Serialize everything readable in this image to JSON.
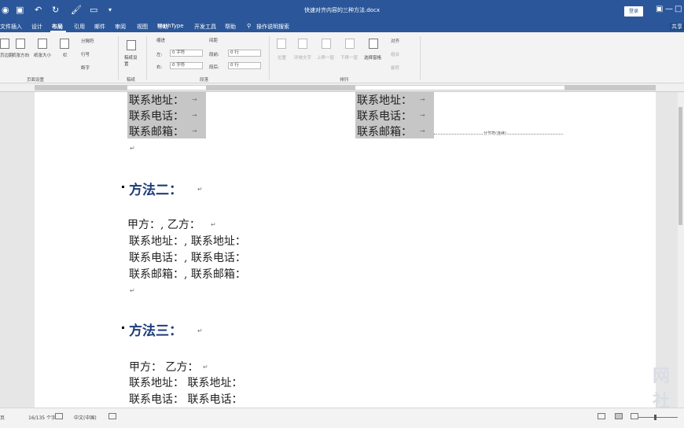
{
  "titlebar": {
    "doc_title": "快速对齐内容的三种方法.docx",
    "login": "登录",
    "minimize": "—",
    "restore": "□",
    "close": "✕"
  },
  "tabs": [
    "文件",
    "插入",
    "设计",
    "布局",
    "引用",
    "邮件",
    "审阅",
    "视图",
    "帮助",
    "MathType",
    "开发工具",
    "帮助",
    "操作说明搜索"
  ],
  "share": "共享",
  "ribbon": {
    "page_setup": {
      "margins": "页边距",
      "orientation": "纸张方向",
      "size": "纸张大小",
      "columns": "栏",
      "breaks": "分隔符",
      "line_numbers": "行号",
      "hyphenation": "断字",
      "label": "页面设置"
    },
    "manuscript": {
      "btn": "稿纸设置",
      "label": "稿纸"
    },
    "paragraph": {
      "indent": "缩进",
      "spacing": "间距",
      "left_label": "左:",
      "left_val": "0 字符",
      "right_label": "右:",
      "right_val": "0 字符",
      "before_label": "段前:",
      "before_val": "0 行",
      "after_label": "段后:",
      "after_val": "0 行",
      "label": "段落"
    },
    "arrange": {
      "position": "位置",
      "wrap": "环绕文字",
      "bring_forward": "上移一层",
      "send_backward": "下移一层",
      "selection_pane": "选择窗格",
      "align": "对齐",
      "group": "组合",
      "rotate": "旋转",
      "label": "排列"
    }
  },
  "document": {
    "col1_top": [
      "联系地址：",
      "联系电话：",
      "联系邮箱："
    ],
    "col2_top": [
      "联系地址：",
      "联系电话：",
      "联系邮箱："
    ],
    "section_break": "分节符(连续)",
    "method2": {
      "title": "方法二：",
      "lines": [
        "甲方：, 乙方：",
        "联系地址：, 联系地址：",
        "联系电话：, 联系电话：",
        "联系邮箱：, 联系邮箱："
      ]
    },
    "method3": {
      "title": "方法三：",
      "lines": [
        "甲方：  乙方：",
        "联系地址：  联系地址：",
        "联系电话：  联系电话："
      ]
    },
    "para_mark": "↵",
    "tab_mark": "→"
  },
  "watermark": "网社",
  "status": {
    "page": "页",
    "words": "16/135 个字",
    "lang": "中文(中国)"
  }
}
